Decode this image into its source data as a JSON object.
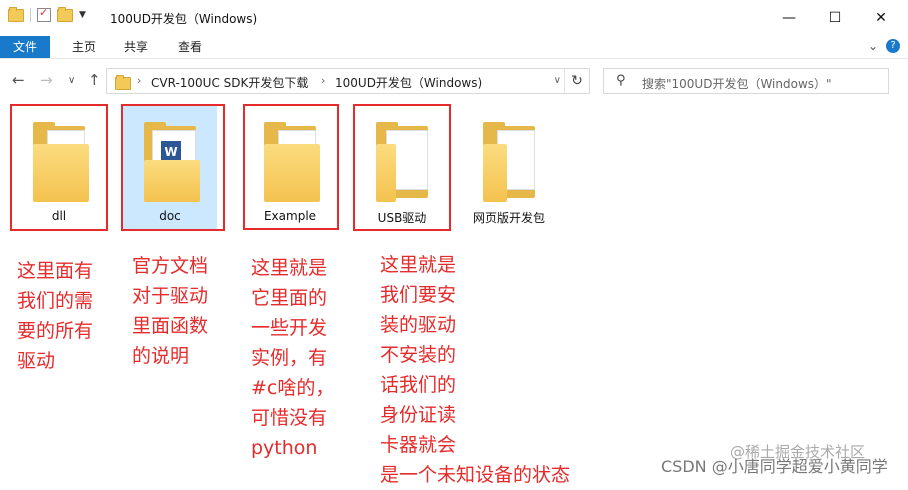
{
  "window": {
    "title": "100UD开发包（Windows)",
    "controls": {
      "minimize": "—",
      "maximize": "☐",
      "close": "✕"
    }
  },
  "ribbon": {
    "tabs": [
      {
        "label": "文件",
        "active": true
      },
      {
        "label": "主页",
        "active": false
      },
      {
        "label": "共享",
        "active": false
      },
      {
        "label": "查看",
        "active": false
      }
    ],
    "expand_icon": "chevron-down-icon",
    "help_icon": "?"
  },
  "navigation": {
    "back": "←",
    "forward": "→",
    "recent": "∨",
    "up": "↑",
    "breadcrumb": [
      "CVR-100UC SDK开发包下载",
      "100UD开发包（Windows)"
    ],
    "refresh": "↻"
  },
  "search": {
    "placeholder": "搜索\"100UD开发包（Windows）\""
  },
  "files": [
    {
      "name": "dll",
      "highlighted": true,
      "selected": false,
      "content_icon": "document-stack-icon"
    },
    {
      "name": "doc",
      "highlighted": true,
      "selected": true,
      "content_icon": "word-doc-icon"
    },
    {
      "name": "Example",
      "highlighted": true,
      "selected": false,
      "content_icon": "document-stack-icon"
    },
    {
      "name": "USB驱动",
      "highlighted": true,
      "selected": false,
      "content_icon": "text-doc-icon"
    },
    {
      "name": "网页版开发包",
      "highlighted": false,
      "selected": false,
      "content_icon": "web-doc-icon"
    }
  ],
  "annotations": [
    "这里面有\n我们的需\n要的所有\n驱动",
    "官方文档\n对于驱动\n里面函数\n的说明",
    "这里就是\n它里面的\n一些开发\n实例，有\n#c啥的，\n可惜没有\npython",
    "这里就是\n我们要安\n装的驱动\n不安装的\n话我们的\n身份证读\n卡器就会\n是一个未知设备的状态"
  ],
  "watermarks": {
    "csdn": "CSDN @小唐同学超爱小黄同学",
    "juejin": "@稀土掘金技术社区"
  },
  "colors": {
    "accent": "#1979ca",
    "annotation_red": "#e52b2b",
    "selection": "#cce8ff",
    "folder": "#f4c24f"
  }
}
